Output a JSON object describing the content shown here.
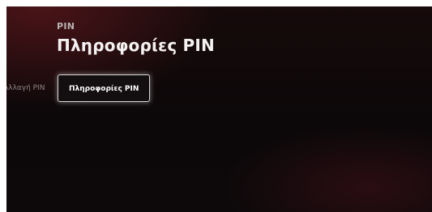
{
  "header": {
    "subtitle": "PIN",
    "title": "Πληροφορίες PIN"
  },
  "tabs": [
    {
      "label": "Αλλαγή PIN",
      "selected": false
    },
    {
      "label": "Πληροφορίες PIN",
      "selected": true
    }
  ],
  "colors": {
    "background": "#0d090a",
    "accent_glow": "#4a1418",
    "focus_border": "#d9d6d6"
  }
}
